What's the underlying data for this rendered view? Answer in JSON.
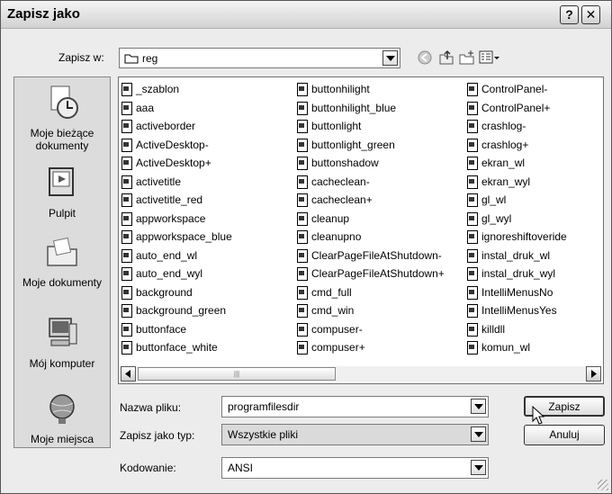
{
  "window": {
    "title": "Zapisz jako",
    "help_label": "?",
    "close_label": "✕"
  },
  "location": {
    "label": "Zapisz w:",
    "value": "reg"
  },
  "toolbar": {
    "back": "back-icon",
    "up": "up-folder-icon",
    "new_folder": "new-folder-icon",
    "view": "view-menu-icon"
  },
  "places": [
    {
      "label": "Moje bieżące dokumenty",
      "icon": "recent-documents-icon"
    },
    {
      "label": "Pulpit",
      "icon": "desktop-icon"
    },
    {
      "label": "Moje dokumenty",
      "icon": "my-documents-icon"
    },
    {
      "label": "Mój komputer",
      "icon": "my-computer-icon"
    },
    {
      "label": "Moje miejsca",
      "icon": "network-places-icon"
    }
  ],
  "files": {
    "col1": [
      "_szablon",
      "aaa",
      "activeborder",
      "ActiveDesktop-",
      "ActiveDesktop+",
      "activetitle",
      "activetitle_red",
      "appworkspace",
      "appworkspace_blue",
      "auto_end_wl",
      "auto_end_wyl",
      "background",
      "background_green",
      "buttonface",
      "buttonface_white"
    ],
    "col2": [
      "buttonhilight",
      "buttonhilight_blue",
      "buttonlight",
      "buttonlight_green",
      "buttonshadow",
      "cacheclean-",
      "cacheclean+",
      "cleanup",
      "cleanupno",
      "ClearPageFileAtShutdown-",
      "ClearPageFileAtShutdown+",
      "cmd_full",
      "cmd_win",
      "compuser-",
      "compuser+"
    ],
    "col3": [
      "ControlPanel-",
      "ControlPanel+",
      "crashlog-",
      "crashlog+",
      "ekran_wl",
      "ekran_wyl",
      "gl_wl",
      "gl_wyl",
      "ignoreshiftoveride",
      "instal_druk_wl",
      "instal_druk_wyl",
      "IntelliMenusNo",
      "IntelliMenusYes",
      "killdll",
      "komun_wl"
    ]
  },
  "form": {
    "filename_label": "Nazwa pliku:",
    "filename_value": "programfilesdir",
    "type_label": "Zapisz jako typ:",
    "type_value": "Wszystkie pliki",
    "encoding_label": "Kodowanie:",
    "encoding_value": "ANSI"
  },
  "buttons": {
    "save": "Zapisz",
    "cancel": "Anuluj"
  },
  "colors": {
    "selection": "#dadada",
    "window_bg": "#ececec"
  }
}
